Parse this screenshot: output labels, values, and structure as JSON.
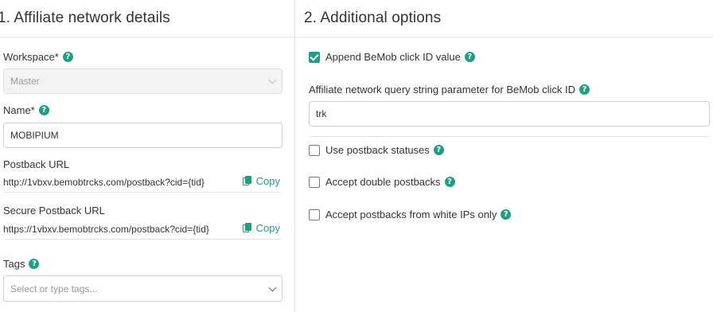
{
  "left": {
    "title": "1. Affiliate network details",
    "workspace": {
      "label": "Workspace*",
      "value": "Master"
    },
    "name": {
      "label": "Name*",
      "value": "MOBIPIUM"
    },
    "postback": {
      "label": "Postback URL",
      "url": "http://1vbxv.bemobtrcks.com/postback?cid={tid}",
      "copy": "Copy"
    },
    "secure_postback": {
      "label": "Secure Postback URL",
      "url": "https://1vbxv.bemobtrcks.com/postback?cid={tid}",
      "copy": "Copy"
    },
    "tags": {
      "label": "Tags",
      "placeholder": "Select or type tags..."
    }
  },
  "right": {
    "title": "2. Additional options",
    "append_click_id": {
      "label": "Append BeMob click ID value",
      "checked": true
    },
    "query_param": {
      "label": "Affiliate network query string parameter for BeMob click ID",
      "value": "trk"
    },
    "postback_statuses": {
      "label": "Use postback statuses",
      "checked": false
    },
    "double_postbacks": {
      "label": "Accept double postbacks",
      "checked": false
    },
    "white_ips": {
      "label": "Accept postbacks from white IPs only",
      "checked": false
    }
  },
  "help_glyph": "?",
  "colors": {
    "accent": "#1f9e82",
    "border": "#cfcfcf",
    "divider": "#e6e6e6"
  }
}
